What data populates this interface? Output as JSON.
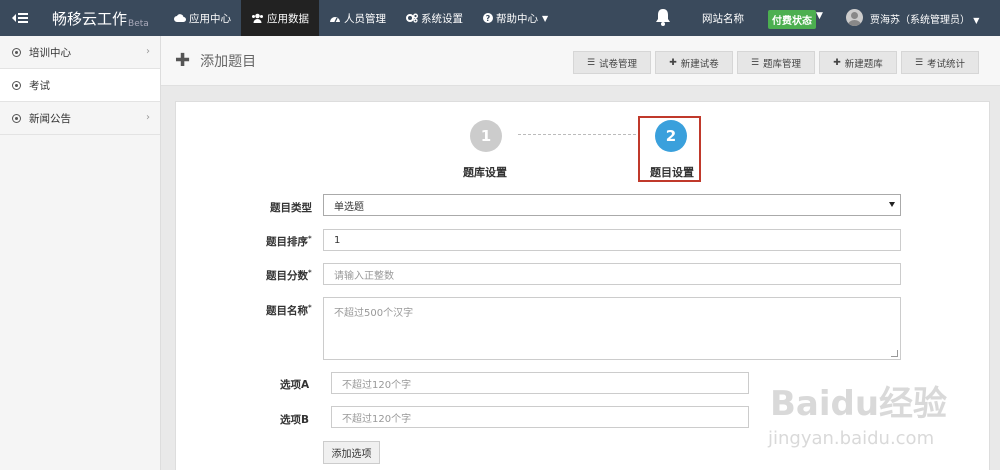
{
  "header": {
    "brand": "畅移云工作",
    "brand_suffix": "Beta",
    "nav": [
      {
        "label": "应用中心",
        "icon": "cloud-icon"
      },
      {
        "label": "应用数据",
        "icon": "users-icon"
      },
      {
        "label": "人员管理",
        "icon": "dashboard-icon"
      },
      {
        "label": "系统设置",
        "icon": "gears-icon"
      },
      {
        "label": "帮助中心",
        "icon": "question-icon"
      }
    ],
    "site_name": "网站名称",
    "pay_status": "付费状态",
    "user": "贾海苏（系统管理员）"
  },
  "sidebar": {
    "items": [
      {
        "label": "培训中心"
      },
      {
        "label": "考试"
      },
      {
        "label": "新闻公告"
      }
    ]
  },
  "page": {
    "title": "添加题目",
    "toolbar": [
      {
        "label": "试卷管理",
        "icon": "list-icon"
      },
      {
        "label": "新建试卷",
        "icon": "plus-icon"
      },
      {
        "label": "题库管理",
        "icon": "list-icon"
      },
      {
        "label": "新建题库",
        "icon": "plus-icon"
      },
      {
        "label": "考试统计",
        "icon": "list-icon"
      }
    ]
  },
  "steps": [
    {
      "number": "1",
      "label": "题库设置"
    },
    {
      "number": "2",
      "label": "题目设置"
    }
  ],
  "form": {
    "type_label": "题目类型",
    "type_value": "单选题",
    "order_label": "题目排序",
    "order_value": "1",
    "score_label": "题目分数",
    "score_placeholder": "请输入正整数",
    "name_label": "题目名称",
    "name_placeholder": "不超过500个汉字",
    "option_a_label": "选项A",
    "option_a_placeholder": "不超过120个字",
    "option_b_label": "选项B",
    "option_b_placeholder": "不超过120个字",
    "add_option": "添加选项",
    "required_mark": "*"
  },
  "watermark": {
    "logo": "Baidu经验",
    "url": "jingyan.baidu.com"
  },
  "colors": {
    "topbar": "#3a4a5c",
    "active_nav": "#222222",
    "pay_badge": "#4caf50",
    "step_active": "#3aa0dc",
    "step_inactive": "#cccccc",
    "highlight": "#c0392b"
  }
}
